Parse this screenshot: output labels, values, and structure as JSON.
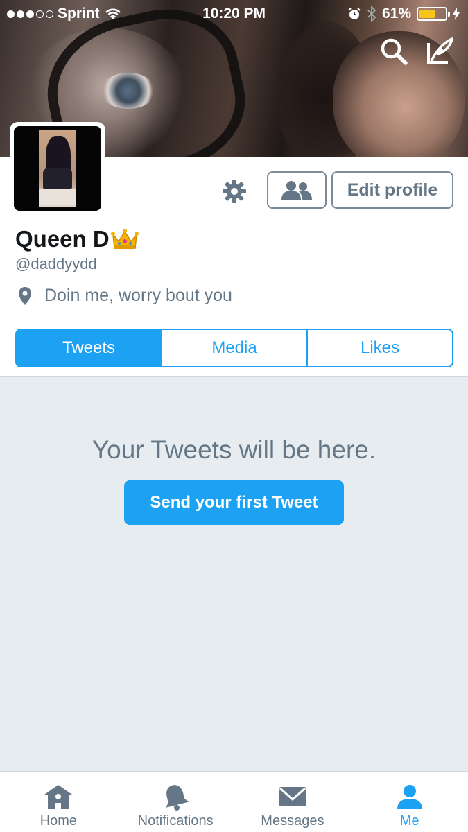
{
  "status_bar": {
    "carrier": "Sprint",
    "time": "10:20 PM",
    "battery": "61%",
    "battery_level": 0.61
  },
  "header": {
    "search_icon": "search-icon",
    "compose_icon": "compose-tweet-icon"
  },
  "profile": {
    "display_name": "Queen D",
    "handle": "@daddyydd",
    "bio": "Doin me, worry bout you",
    "edit_button": "Edit profile"
  },
  "tabs": [
    {
      "label": "Tweets",
      "active": true
    },
    {
      "label": "Media",
      "active": false
    },
    {
      "label": "Likes",
      "active": false
    }
  ],
  "empty_state": {
    "message": "Your Tweets will be here.",
    "cta": "Send your first Tweet"
  },
  "tabbar": [
    {
      "label": "Home",
      "icon": "home-icon"
    },
    {
      "label": "Notifications",
      "icon": "bell-icon"
    },
    {
      "label": "Messages",
      "icon": "envelope-icon"
    },
    {
      "label": "Me",
      "icon": "person-icon",
      "active": true
    }
  ],
  "colors": {
    "accent": "#1da1f2",
    "muted": "#657786",
    "background": "#e6ecf0",
    "battery": "#f5c519"
  }
}
